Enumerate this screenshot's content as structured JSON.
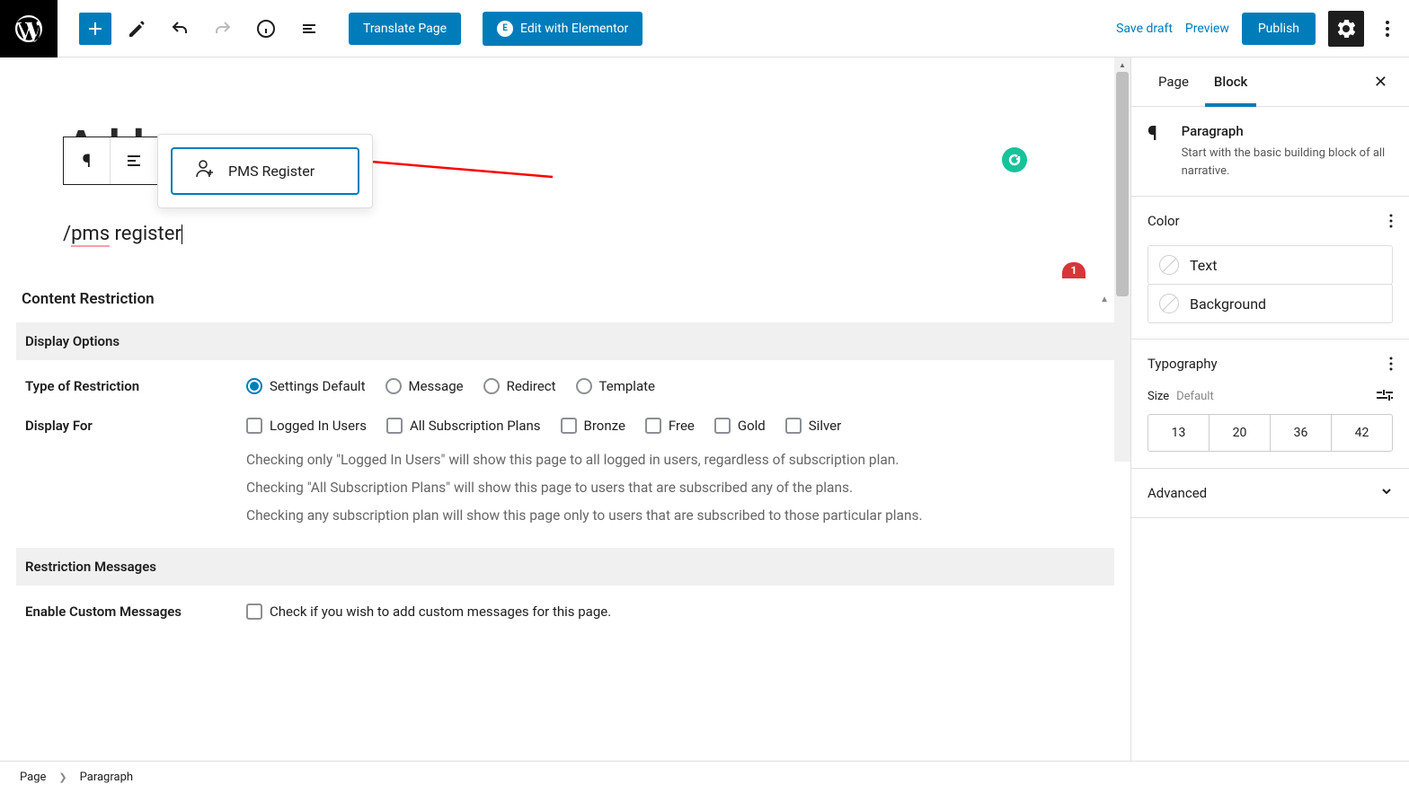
{
  "toolbar": {
    "translate_label": "Translate Page",
    "elementor_label": "Edit with Elementor",
    "save_draft": "Save draft",
    "preview": "Preview",
    "publish": "Publish"
  },
  "editor": {
    "title_hint": "Add",
    "paragraph_prefix": "/",
    "paragraph_underlined": "pms",
    "paragraph_rest": " register",
    "suggest_label": "PMS Register",
    "notification_count": "1"
  },
  "content_restriction": {
    "heading": "Content Restriction",
    "display_options_heading": "Display Options",
    "type_label": "Type of Restriction",
    "type_options": [
      "Settings Default",
      "Message",
      "Redirect",
      "Template"
    ],
    "type_selected_index": 0,
    "display_for_label": "Display For",
    "display_for_options": [
      "Logged In Users",
      "All Subscription Plans",
      "Bronze",
      "Free",
      "Gold",
      "Silver"
    ],
    "help_line1": "Checking only \"Logged In Users\" will show this page to all logged in users, regardless of subscription plan.",
    "help_line2": "Checking \"All Subscription Plans\" will show this page to users that are subscribed any of the plans.",
    "help_line3": "Checking any subscription plan will show this page only to users that are subscribed to those particular plans.",
    "restriction_messages_heading": "Restriction Messages",
    "enable_custom_label": "Enable Custom Messages",
    "enable_custom_text": "Check if you wish to add custom messages for this page."
  },
  "sidebar": {
    "tabs": {
      "page": "Page",
      "block": "Block"
    },
    "block_info": {
      "title": "Paragraph",
      "desc": "Start with the basic building block of all narrative."
    },
    "color": {
      "heading": "Color",
      "text": "Text",
      "background": "Background"
    },
    "typography": {
      "heading": "Typography",
      "size_label": "Size",
      "size_value": "Default",
      "sizes": [
        "13",
        "20",
        "36",
        "42"
      ]
    },
    "advanced": {
      "heading": "Advanced"
    }
  },
  "breadcrumb": {
    "root": "Page",
    "current": "Paragraph"
  }
}
